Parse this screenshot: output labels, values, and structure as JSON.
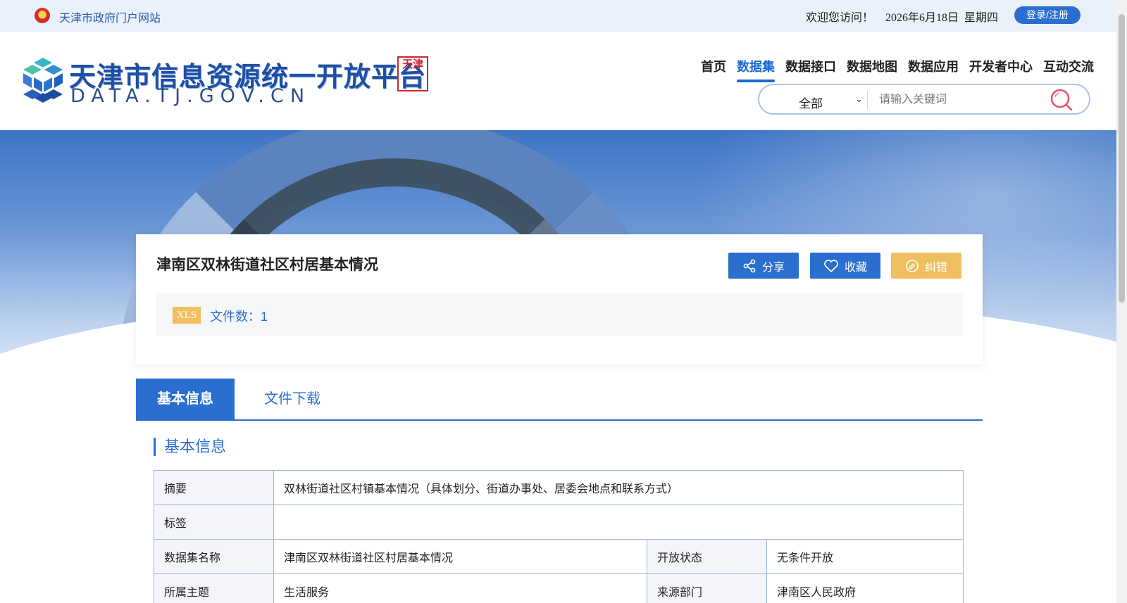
{
  "topbar": {
    "gov_link": "天津市政府门户网站",
    "welcome": "欢迎您访问！",
    "date": "2026年6月18日",
    "weekday": "星期四",
    "login": "登录/注册"
  },
  "header": {
    "title": "天津市信息资源统一开放平台",
    "subtitle": "DATA.TJ.GOV.CN",
    "seal_text": "天津"
  },
  "nav": {
    "items": [
      "首页",
      "数据集",
      "数据接口",
      "数据地图",
      "数据应用",
      "开发者中心",
      "互动交流"
    ],
    "active_index": 1
  },
  "search": {
    "scope": "全部",
    "placeholder": "请输入关键词"
  },
  "dataset": {
    "title": "津南区双林街道社区村居基本情况",
    "share": "分享",
    "favorite": "收藏",
    "report_error": "纠错",
    "file_type": "XLS",
    "file_count": "文件数：1"
  },
  "tabs": {
    "basic": "基本信息",
    "download": "文件下载"
  },
  "section": {
    "title": "基本信息"
  },
  "info": {
    "summary_label": "摘要",
    "summary_value": "双林街道社区村镇基本情况（具体划分、街道办事处、居委会地点和联系方式）",
    "tags_label": "标签",
    "tags_value": "",
    "name_label": "数据集名称",
    "name_value": "津南区双林街道社区村居基本情况",
    "open_label": "开放状态",
    "open_value": "无条件开放",
    "topic_label": "所属主题",
    "topic_value": "生活服务",
    "source_label": "来源部门",
    "source_value": "津南区人民政府"
  },
  "colors": {
    "primary": "#2a6fd0",
    "accent_yellow": "#f0c060",
    "topbar_bg": "#e9f1fb"
  }
}
